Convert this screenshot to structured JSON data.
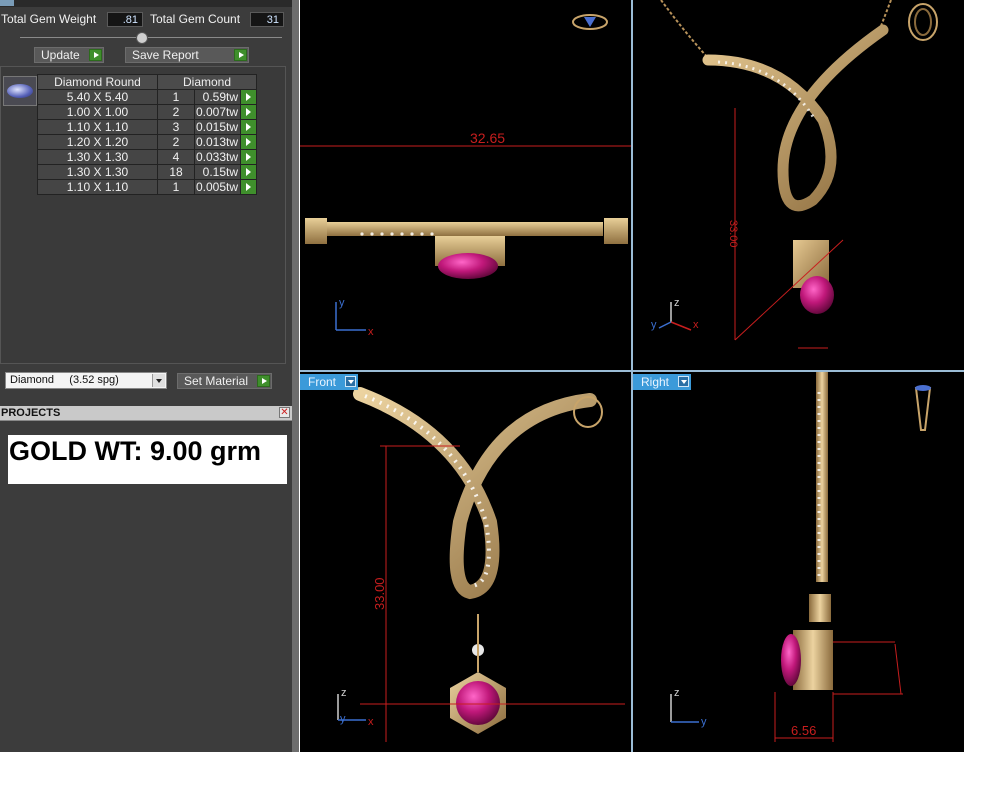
{
  "gem_stats": {
    "total_weight_label": "Total Gem Weight",
    "total_weight_value": ".81",
    "total_count_label": "Total Gem Count",
    "total_count_value": "31"
  },
  "actions": {
    "update_label": "Update",
    "save_report_label": "Save Report"
  },
  "gem_table": {
    "headers": [
      "Diamond Round",
      "Diamond"
    ],
    "rows": [
      {
        "size": "5.40 X 5.40",
        "qty": "1",
        "weight": "0.59tw"
      },
      {
        "size": "1.00 X 1.00",
        "qty": "2",
        "weight": "0.007tw"
      },
      {
        "size": "1.10 X 1.10",
        "qty": "3",
        "weight": "0.015tw"
      },
      {
        "size": "1.20 X 1.20",
        "qty": "2",
        "weight": "0.013tw"
      },
      {
        "size": "1.30 X 1.30",
        "qty": "4",
        "weight": "0.033tw"
      },
      {
        "size": "1.30 X 1.30",
        "qty": "18",
        "weight": "0.15tw"
      },
      {
        "size": "1.10 X 1.10",
        "qty": "1",
        "weight": "0.005tw"
      }
    ]
  },
  "material": {
    "selected": "Diamond     (3.52 spg)",
    "set_label": "Set Material"
  },
  "projects": {
    "title": "PROJECTS",
    "close_icon": "close-icon"
  },
  "note": {
    "text": "GOLD WT: 9.00 grm"
  },
  "viewports": {
    "top_left": {
      "dimension": "32.65",
      "axis_x": "x",
      "axis_y": "y"
    },
    "top_right": {
      "dimension": "33.00",
      "axis_x": "x",
      "axis_y": "y",
      "axis_z": "z"
    },
    "bottom_left": {
      "label": "Front",
      "dimension": "33.00",
      "axis_x": "x",
      "axis_y": "y",
      "axis_z": "z"
    },
    "bottom_right": {
      "label": "Right",
      "dimension": "6.56",
      "axis_y": "y",
      "axis_z": "z"
    }
  },
  "colors": {
    "gold": "#c8a46a",
    "ruby": "#c0187a",
    "dimension_red": "#c81e1e",
    "viewport_tab": "#3b9ad9",
    "panel_bg": "#3c3c3c"
  }
}
